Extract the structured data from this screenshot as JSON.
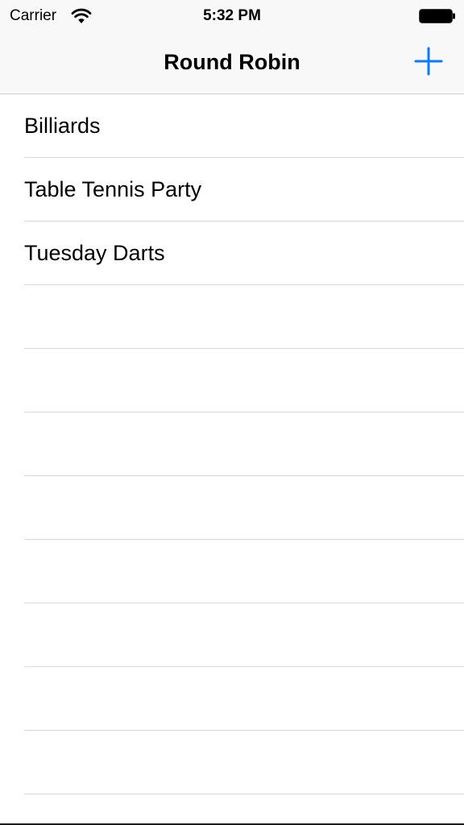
{
  "status_bar": {
    "carrier": "Carrier",
    "time": "5:32 PM",
    "wifi_icon": "wifi-icon",
    "battery_icon": "battery-icon"
  },
  "nav_bar": {
    "title": "Round Robin",
    "add_icon": "plus-icon"
  },
  "colors": {
    "accent": "#0a7aff",
    "chrome_background": "#f8f8f8",
    "separator": "#d9d9dc"
  },
  "list": {
    "items": [
      {
        "label": "Billiards"
      },
      {
        "label": "Table Tennis Party"
      },
      {
        "label": "Tuesday Darts"
      },
      {
        "label": ""
      },
      {
        "label": ""
      },
      {
        "label": ""
      },
      {
        "label": ""
      },
      {
        "label": ""
      },
      {
        "label": ""
      },
      {
        "label": ""
      },
      {
        "label": ""
      }
    ]
  }
}
